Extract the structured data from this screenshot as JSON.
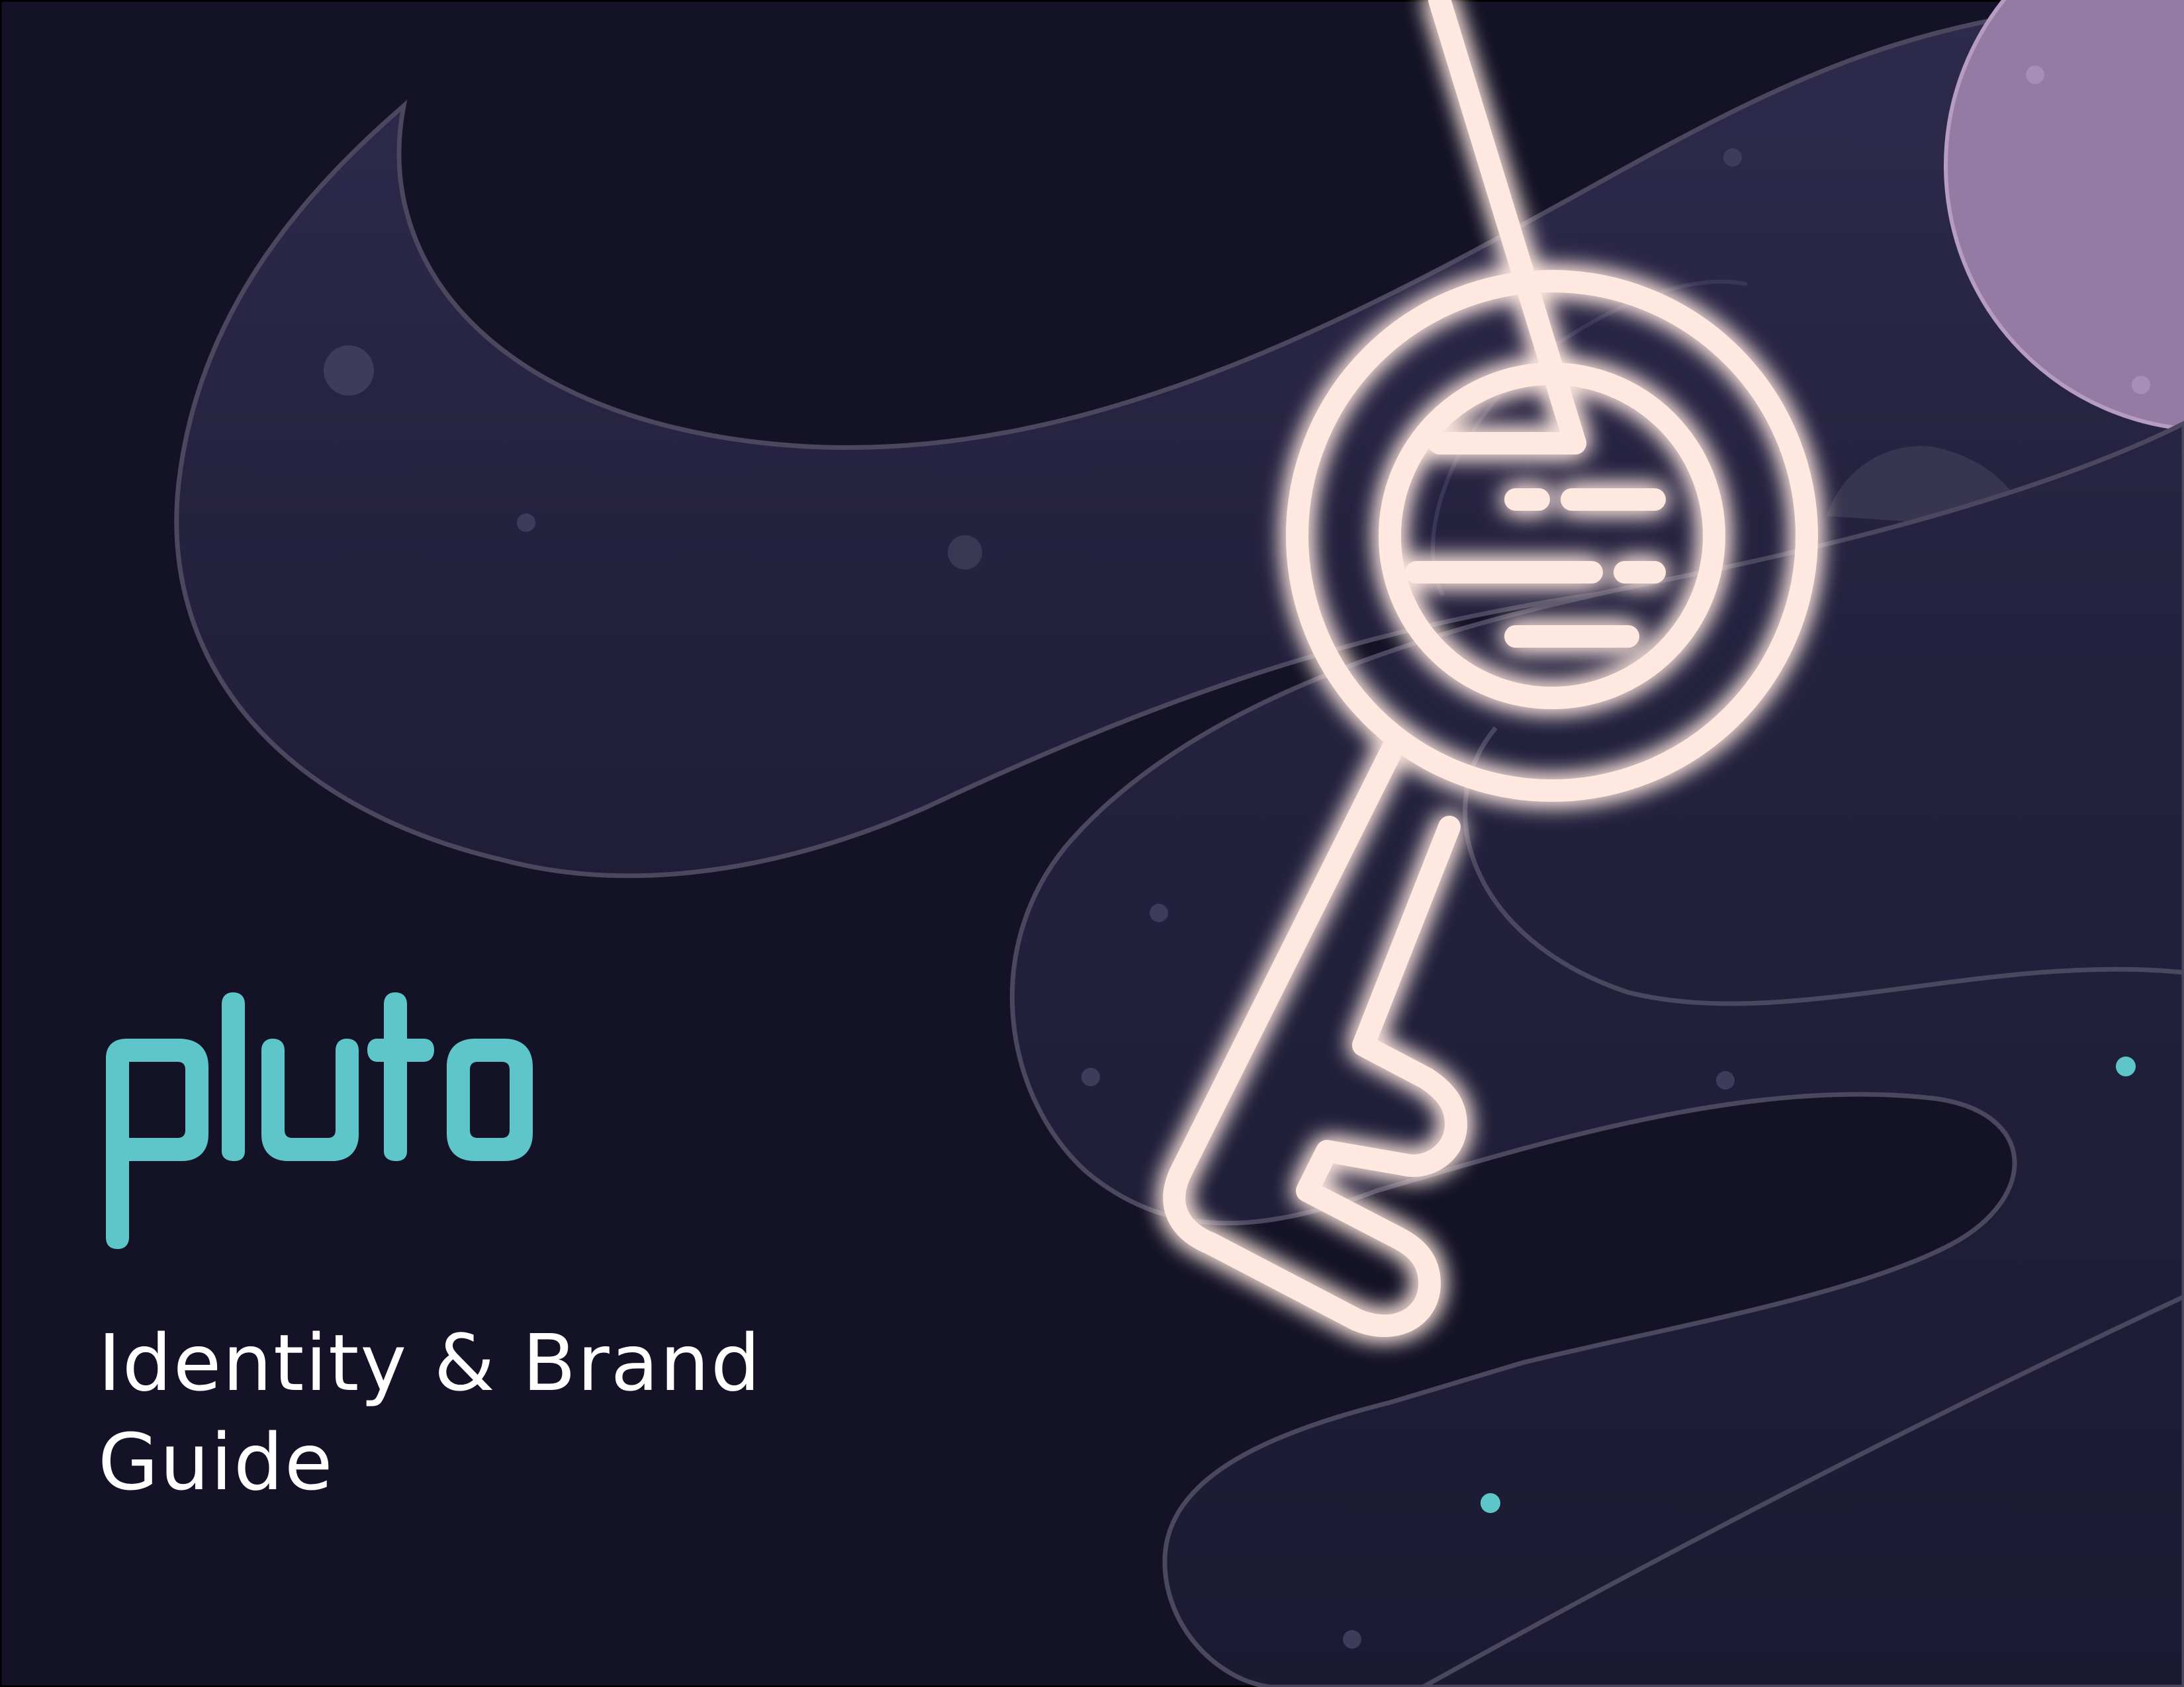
{
  "brand": {
    "name": "pluto"
  },
  "subtitle": {
    "line1": "Identity & Brand",
    "line2": "Guide"
  },
  "colors": {
    "background": "#131226",
    "wave": "#2a2748",
    "wave_outline": "#4a475f",
    "planet": "#957aa3",
    "accent_teal": "#5ec6c8",
    "key_glow": "#ffe8e0",
    "subtitle_text": "#ffffff"
  },
  "icons": {
    "hero": "key-with-planet-icon"
  }
}
